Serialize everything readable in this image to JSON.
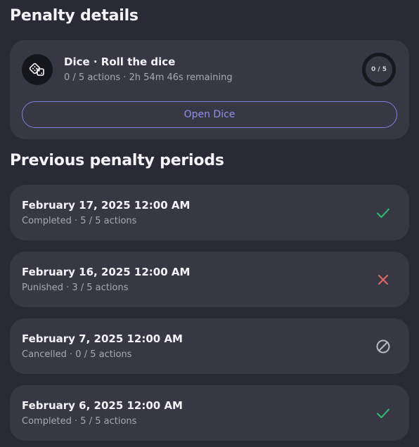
{
  "penalty_details": {
    "heading": "Penalty details",
    "task": {
      "icon": "dice-icon",
      "title": "Dice · Roll the dice",
      "subtitle": "0 / 5 actions · 2h 54m 46s remaining",
      "progress_label": "0 / 5",
      "progress_fraction": 0
    },
    "open_button_label": "Open Dice",
    "colors": {
      "accent": "#8c91ee"
    }
  },
  "previous_periods": {
    "heading": "Previous penalty periods",
    "items": [
      {
        "date": "February 17, 2025 12:00 AM",
        "summary": "Completed · 5 / 5 actions",
        "status": "completed",
        "icon": "check-icon",
        "color": "#2fbf71"
      },
      {
        "date": "February 16, 2025 12:00 AM",
        "summary": "Punished · 3 / 5 actions",
        "status": "punished",
        "icon": "close-icon",
        "color": "#e9685f"
      },
      {
        "date": "February 7, 2025 12:00 AM",
        "summary": "Cancelled · 0 / 5 actions",
        "status": "cancelled",
        "icon": "cancel-circle-icon",
        "color": "#b9b9c6"
      },
      {
        "date": "February 6, 2025 12:00 AM",
        "summary": "Completed · 5 / 5 actions",
        "status": "completed",
        "icon": "check-icon",
        "color": "#2fbf71"
      }
    ]
  }
}
